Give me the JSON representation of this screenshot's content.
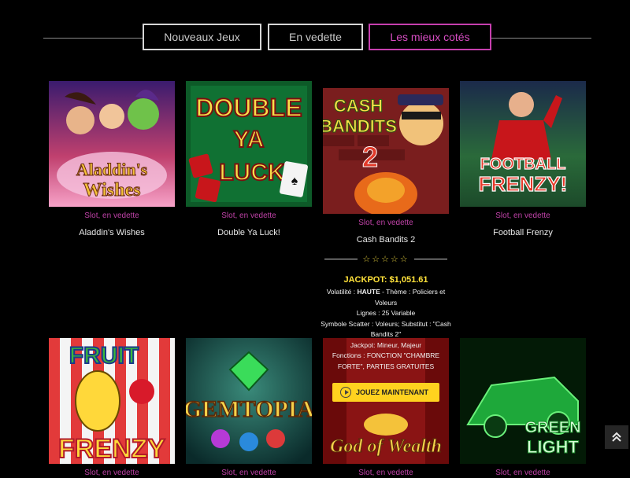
{
  "tabs": [
    {
      "label": "Nouveaux Jeux",
      "active": false
    },
    {
      "label": "En vedette",
      "active": false
    },
    {
      "label": "Les mieux cotés",
      "active": true
    }
  ],
  "games": [
    {
      "title": "Aladdin's Wishes",
      "category": "Slot, en vedette",
      "art_text": [
        "Aladdin's",
        "Wishes"
      ]
    },
    {
      "title": "Double Ya Luck!",
      "category": "Slot, en vedette",
      "art_text": [
        "DOUBLE",
        "YA",
        "LUCK"
      ]
    },
    {
      "title": "Cash Bandits 2",
      "category": "Slot, en vedette",
      "art_text": [
        "CASH",
        "BANDITS",
        "2"
      ]
    },
    {
      "title": "Football Frenzy",
      "category": "Slot, en vedette",
      "art_text": [
        "FOOTBALL",
        "FRENZY!"
      ]
    },
    {
      "category": "Slot, en vedette",
      "art_text": [
        "FRUIT",
        "FRENZY"
      ]
    },
    {
      "category": "Slot, en vedette",
      "art_text": [
        "GEMTOPIA"
      ]
    },
    {
      "category": "Slot, en vedette",
      "art_text": [
        "God of Wealth"
      ]
    },
    {
      "category": "Slot, en vedette",
      "art_text": [
        "GREEN",
        "LIGHT"
      ]
    }
  ],
  "details": {
    "stars": "☆☆☆☆☆",
    "jackpot": "JACKPOT: $1,051.61",
    "volatility_label": "Volatilité :",
    "volatility_value": "HAUTE",
    "theme": "- Thème : Policiers et Voleurs",
    "lines": "Lignes : 25 Variable",
    "symbols": "Symbole Scatter : Voleurs; Substitut : \"Cash Bandits 2\"",
    "jackpot_type": "Jackpot: Mineur, Majeur",
    "features": "Fonctions : FONCTION \"CHAMBRE FORTE\", PARTIES GRATUITES",
    "play_label": "JOUEZ MAINTENANT"
  },
  "scroll_top_icon": "chevron-double-up",
  "colors": {
    "accent": "#c63fae",
    "category": "#c042a8",
    "jackpot": "#ffe23a",
    "button": "#ffd21f"
  }
}
